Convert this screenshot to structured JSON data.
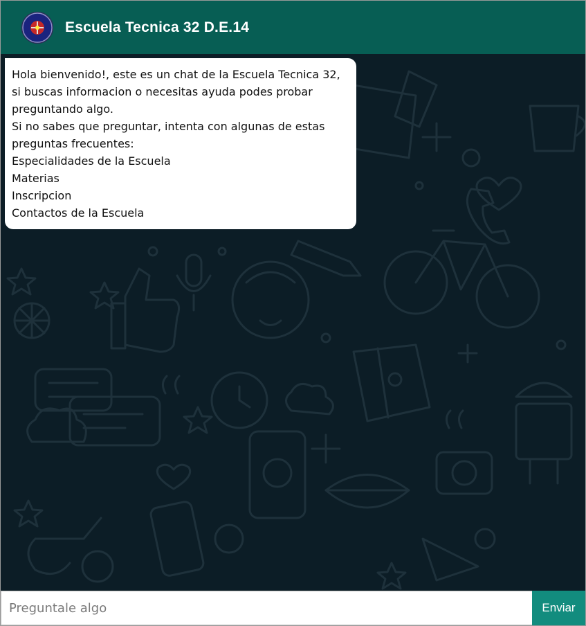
{
  "header": {
    "title": "Escuela Tecnica 32 D.E.14",
    "logo_icon": "school-crest-icon",
    "background_color": "#075e54"
  },
  "chat": {
    "background_color": "#0c1d26",
    "messages": [
      {
        "from": "bot",
        "lines": [
          "Hola bienvenido!, este es un chat de la Escuela Tecnica 32, si buscas informacion o necesitas ayuda podes probar preguntando algo.",
          "Si no sabes que preguntar, intenta con algunas de estas preguntas frecuentes:",
          "Especialidades de la Escuela",
          "Materias",
          "Inscripcion",
          "Contactos de la Escuela"
        ]
      }
    ]
  },
  "composer": {
    "placeholder": "Preguntale algo",
    "value": "",
    "send_label": "Enviar",
    "send_color": "#128c7e"
  }
}
